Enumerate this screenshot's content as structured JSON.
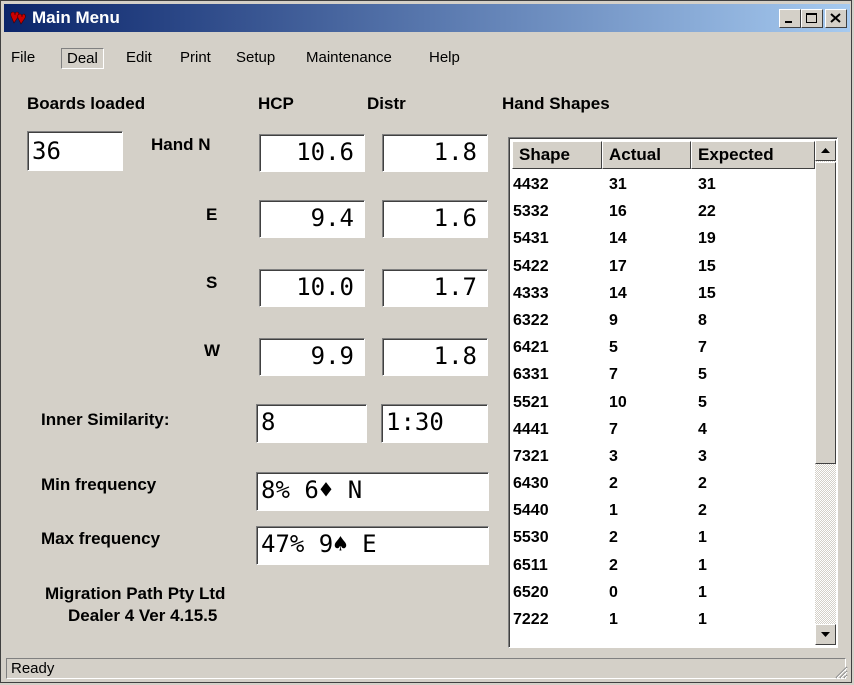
{
  "window": {
    "title": "Main Menu",
    "app_icon": "bridge-hearts-icon"
  },
  "menu": [
    "File",
    "Deal",
    "Edit",
    "Print",
    "Setup",
    "Maintenance",
    "Help"
  ],
  "labels": {
    "boards_loaded": "Boards loaded",
    "hcp": "HCP",
    "distr": "Distr",
    "hand_shapes": "Hand Shapes",
    "hand_n": "Hand N",
    "hand_e": "E",
    "hand_s": "S",
    "hand_w": "W",
    "inner_similarity": "Inner Similarity:",
    "min_frequency": "Min frequency",
    "max_frequency": "Max frequency",
    "company": "Migration Path Pty Ltd",
    "version": "Dealer 4 Ver 4.15.5"
  },
  "values": {
    "boards_loaded": "36",
    "hcp_n": "10.6",
    "distr_n": "1.8",
    "hcp_e": "9.4",
    "distr_e": "1.6",
    "hcp_s": "10.0",
    "distr_s": "1.7",
    "hcp_w": "9.9",
    "distr_w": "1.8",
    "similarity_a": "8",
    "similarity_b": "1:30",
    "min_frequency": "8% 6♦ N",
    "max_frequency": "47% 9♠ E"
  },
  "table": {
    "columns": [
      "Shape",
      "Actual",
      "Expected"
    ],
    "rows": [
      [
        "4432",
        "31",
        "31"
      ],
      [
        "5332",
        "16",
        "22"
      ],
      [
        "5431",
        "14",
        "19"
      ],
      [
        "5422",
        "17",
        "15"
      ],
      [
        "4333",
        "14",
        "15"
      ],
      [
        "6322",
        "9",
        "8"
      ],
      [
        "6421",
        "5",
        "7"
      ],
      [
        "6331",
        "7",
        "5"
      ],
      [
        "5521",
        "10",
        "5"
      ],
      [
        "4441",
        "7",
        "4"
      ],
      [
        "7321",
        "3",
        "3"
      ],
      [
        "6430",
        "2",
        "2"
      ],
      [
        "5440",
        "1",
        "2"
      ],
      [
        "5530",
        "2",
        "1"
      ],
      [
        "6511",
        "2",
        "1"
      ],
      [
        "6520",
        "0",
        "1"
      ],
      [
        "7222",
        "1",
        "1"
      ]
    ]
  },
  "status": "Ready",
  "colors": {
    "titlebar_start": "#0a246a",
    "titlebar_end": "#a6caf0",
    "face": "#d4d0c8",
    "icon_red": "#cc0000"
  }
}
